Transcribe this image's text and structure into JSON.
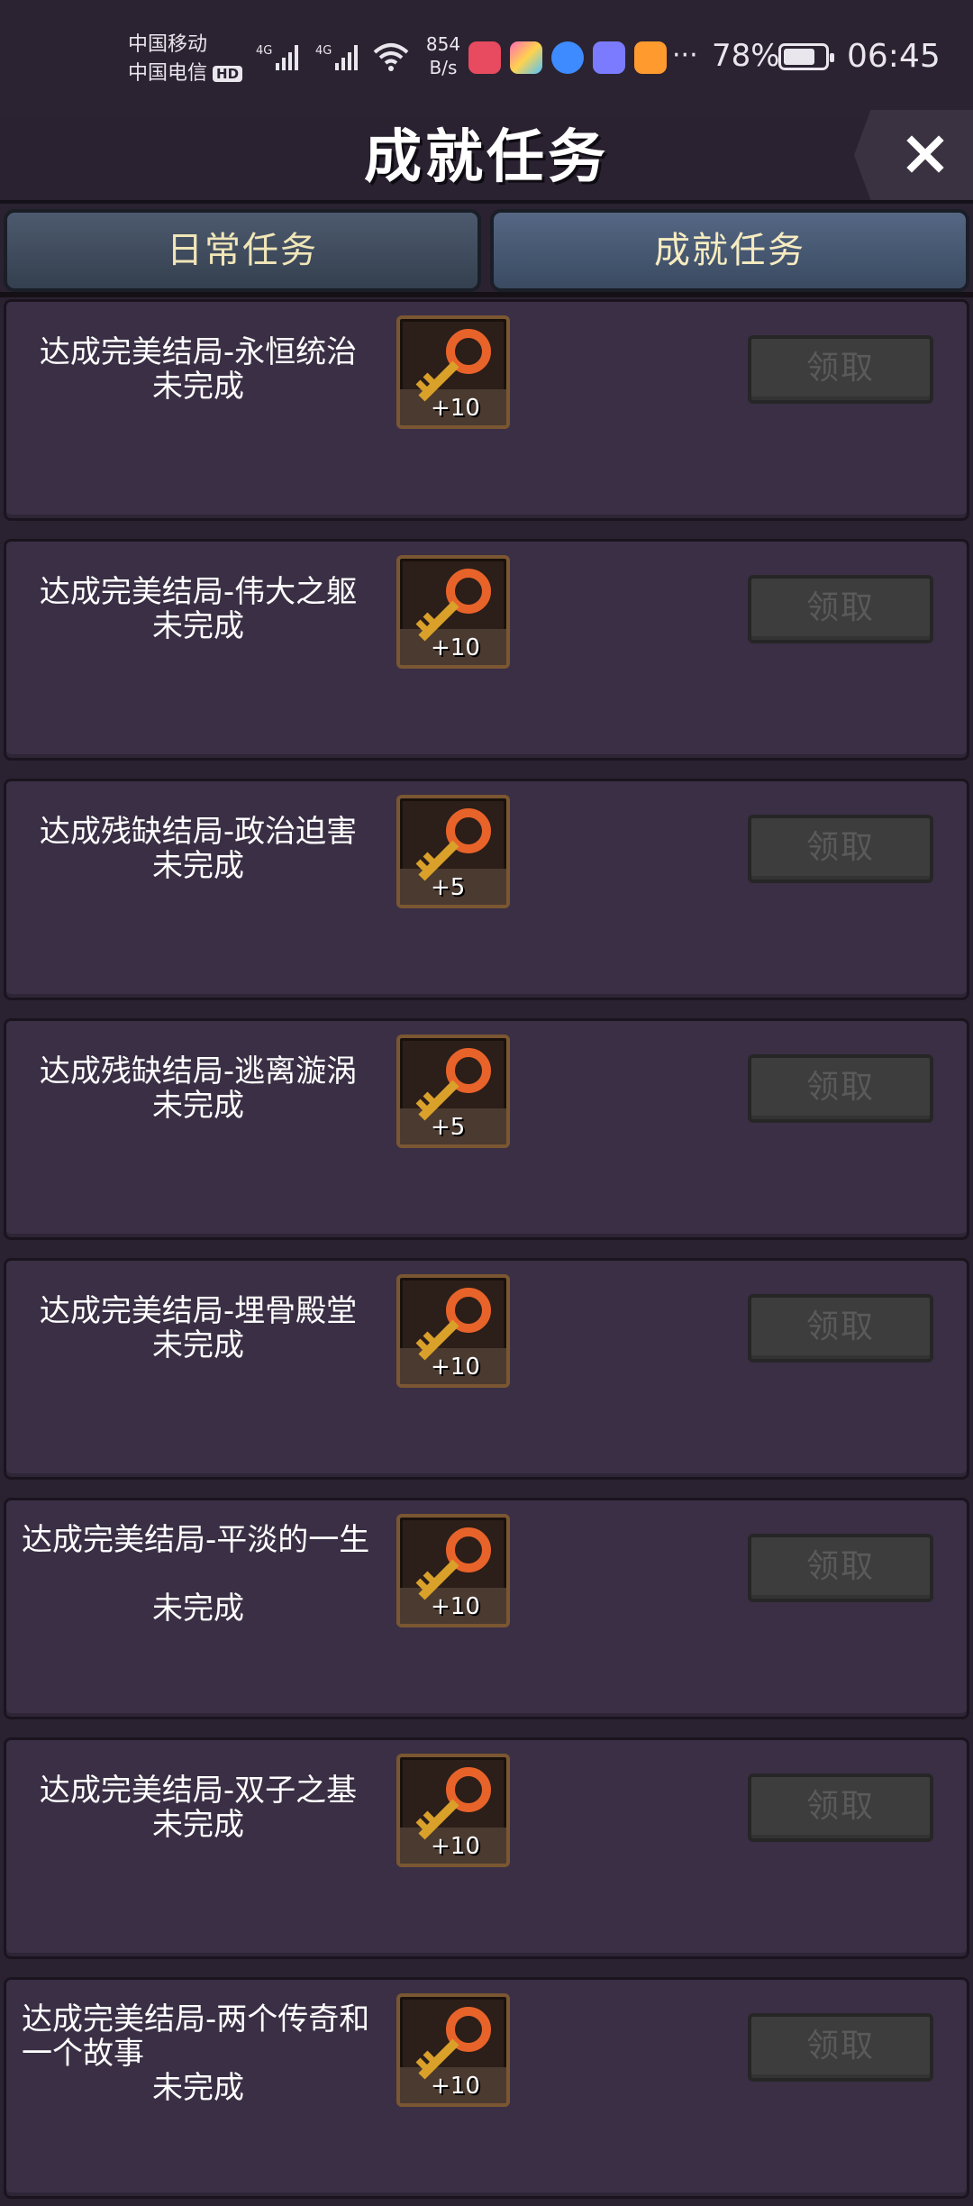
{
  "status_bar": {
    "carrier1": "中国移动",
    "carrier2": "中国电信",
    "hd": "HD",
    "net1": "4G",
    "net2": "4G",
    "speed_value": "854",
    "speed_unit": "B/s",
    "more": "···",
    "battery_text": "78%",
    "battery_level": 0.78,
    "time": "06:45"
  },
  "header": {
    "title": "成就任务",
    "close_icon": "close-icon"
  },
  "tabs": [
    {
      "label": "日常任务",
      "active": false
    },
    {
      "label": "成就任务",
      "active": true
    }
  ],
  "tasks": [
    {
      "name": "达成完美结局-永恒统治",
      "status": "未完成",
      "reward_icon": "key-icon",
      "reward": "+10",
      "claim": "领取"
    },
    {
      "name": "达成完美结局-伟大之躯",
      "status": "未完成",
      "reward_icon": "key-icon",
      "reward": "+10",
      "claim": "领取"
    },
    {
      "name": "达成残缺结局-政治迫害",
      "status": "未完成",
      "reward_icon": "key-icon",
      "reward": "+5",
      "claim": "领取"
    },
    {
      "name": "达成残缺结局-逃离漩涡",
      "status": "未完成",
      "reward_icon": "key-icon",
      "reward": "+5",
      "claim": "领取"
    },
    {
      "name": "达成完美结局-埋骨殿堂",
      "status": "未完成",
      "reward_icon": "key-icon",
      "reward": "+10",
      "claim": "领取"
    },
    {
      "name": "达成完美结局-平淡的一生",
      "status": "未完成",
      "reward_icon": "key-icon",
      "reward": "+10",
      "claim": "领取"
    },
    {
      "name": "达成完美结局-双子之基",
      "status": "未完成",
      "reward_icon": "key-icon",
      "reward": "+10",
      "claim": "领取"
    },
    {
      "name": "达成完美结局-两个传奇和一个故事",
      "status": "未完成",
      "reward_icon": "key-icon",
      "reward": "+10",
      "claim": "领取"
    }
  ],
  "colors": {
    "background": "#2a2231",
    "card": "#3a2f44",
    "tab_text": "#f1e6b8",
    "claim_disabled": "#3d3d3d",
    "key": "#e8632a"
  }
}
